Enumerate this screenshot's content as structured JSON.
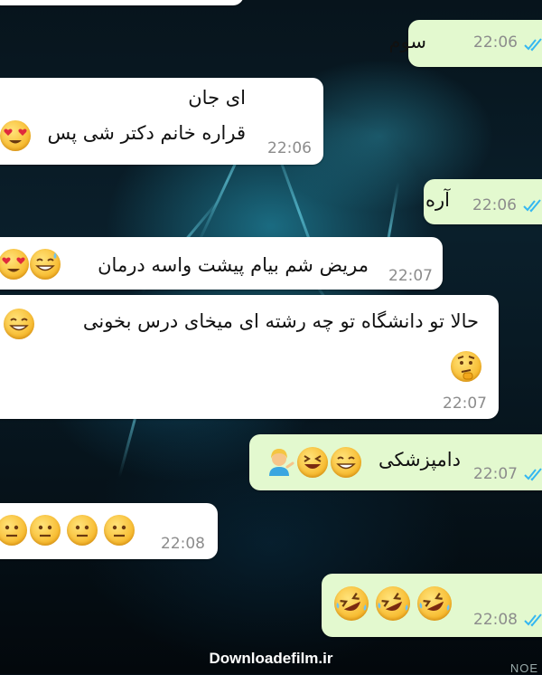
{
  "chat": {
    "messages": [
      {
        "id": "m1",
        "direction": "outgoing",
        "text": "سوم",
        "time": "22:06",
        "status": "read"
      },
      {
        "id": "m2",
        "direction": "incoming",
        "lines": [
          "ای جان",
          "قراره خانم دکتر شی پس"
        ],
        "emojis": [
          "heart-eyes"
        ],
        "time": "22:06"
      },
      {
        "id": "m3",
        "direction": "outgoing",
        "text": "آره",
        "time": "22:06",
        "status": "read"
      },
      {
        "id": "m4",
        "direction": "incoming",
        "text": "مریض شم بیام پیشت واسه درمان",
        "emojis": [
          "grin-sweat",
          "heart-eyes"
        ],
        "time": "22:07"
      },
      {
        "id": "m5",
        "direction": "incoming",
        "text": "حالا تو دانشگاه تو چه رشته ای میخای درس بخونی",
        "emojis": [
          "grin",
          "thinking"
        ],
        "time": "22:07"
      },
      {
        "id": "m6",
        "direction": "outgoing",
        "text": "دامپزشکی",
        "emojis": [
          "grin",
          "laughing",
          "woman-tipping-hand"
        ],
        "time": "22:07",
        "status": "read"
      },
      {
        "id": "m7",
        "direction": "incoming",
        "emojis": [
          "neutral",
          "neutral",
          "neutral",
          "neutral"
        ],
        "time": "22:08"
      },
      {
        "id": "m8",
        "direction": "outgoing",
        "emojis": [
          "rofl",
          "rofl",
          "rofl"
        ],
        "time": "22:08",
        "status": "read"
      }
    ]
  },
  "watermark": {
    "text": "Downloadefilm.ir",
    "corner": "NOE"
  },
  "colors": {
    "incoming_bubble": "#ffffff",
    "outgoing_bubble": "#e3f9cf",
    "read_check": "#34b7f1",
    "time": "#8c8c8c"
  }
}
